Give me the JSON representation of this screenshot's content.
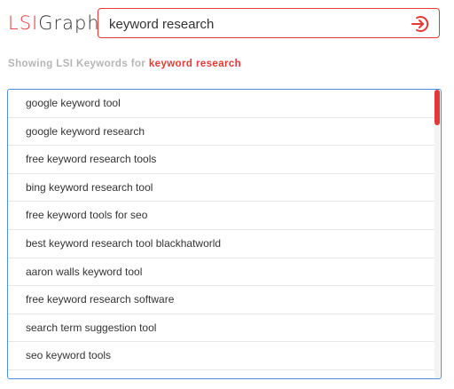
{
  "logo": {
    "lsi": "LSI",
    "graph": "Graph"
  },
  "search": {
    "value": "keyword research",
    "button_icon": "arrow-circle-icon"
  },
  "subtitle": {
    "prefix": "Showing LSI Keywords for",
    "query": "keyword research"
  },
  "results": [
    "google keyword tool",
    "google keyword research",
    "free keyword research tools",
    "bing keyword research tool",
    "free keyword tools for seo",
    "best keyword research tool blackhatworld",
    "aaron walls keyword tool",
    "free keyword research software",
    "search term suggestion tool",
    "seo keyword tools"
  ],
  "colors": {
    "accent": "#e53935",
    "list_border": "#4a90e2"
  }
}
